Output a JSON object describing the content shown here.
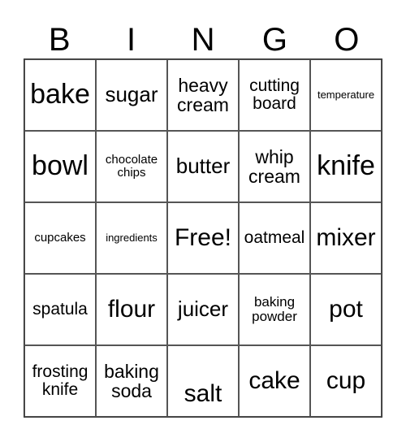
{
  "header": [
    "B",
    "I",
    "N",
    "G",
    "O"
  ],
  "rows": [
    [
      "bake",
      "sugar",
      "heavy cream",
      "cutting board",
      "temperature"
    ],
    [
      "bowl",
      "chocolate chips",
      "butter",
      "whip cream",
      "knife"
    ],
    [
      "cupcakes",
      "ingredients",
      "Free!",
      "oatmeal",
      "mixer"
    ],
    [
      "spatula",
      "flour",
      "juicer",
      "baking powder",
      "pot"
    ],
    [
      "frosting knife",
      "baking soda",
      "salt",
      "cake",
      "cup"
    ]
  ]
}
